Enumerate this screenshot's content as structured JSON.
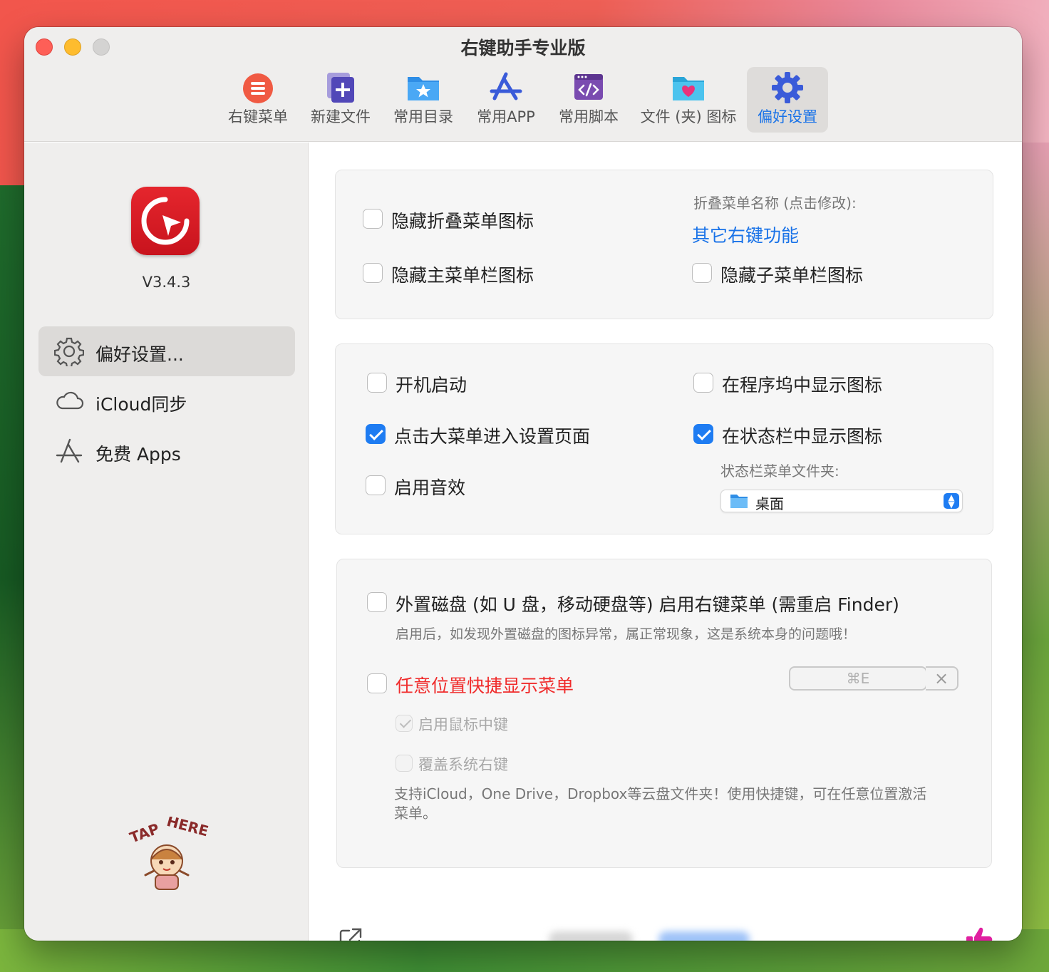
{
  "window": {
    "title": "右键助手专业版"
  },
  "toolbar": {
    "items": [
      {
        "label": "右键菜单",
        "icon": "context-menu-icon"
      },
      {
        "label": "新建文件",
        "icon": "new-file-icon"
      },
      {
        "label": "常用目录",
        "icon": "favorite-folder-icon"
      },
      {
        "label": "常用APP",
        "icon": "app-store-icon"
      },
      {
        "label": "常用脚本",
        "icon": "script-icon"
      },
      {
        "label": "文件 (夹) 图标",
        "icon": "folder-heart-icon"
      },
      {
        "label": "偏好设置",
        "icon": "gear-icon",
        "active": true
      }
    ]
  },
  "sidebar": {
    "version": "V3.4.3",
    "items": [
      {
        "label": "偏好设置...",
        "icon": "gear-icon",
        "active": true
      },
      {
        "label": "iCloud同步",
        "icon": "cloud-icon"
      },
      {
        "label": "免费 Apps",
        "icon": "app-store-icon"
      }
    ],
    "mascot_text": "TAP HERE"
  },
  "panel1": {
    "hide_fold_icon": {
      "label": "隐藏折叠菜单图标",
      "checked": false
    },
    "hide_main_icon": {
      "label": "隐藏主菜单栏图标",
      "checked": false
    },
    "fold_name_caption": "折叠菜单名称 (点击修改):",
    "fold_name_value": "其它右键功能",
    "hide_sub_icon": {
      "label": "隐藏子菜单栏图标",
      "checked": false
    }
  },
  "panel2": {
    "launch_at_login": {
      "label": "开机启动",
      "checked": false
    },
    "click_enter_settings": {
      "label": "点击大菜单进入设置页面",
      "checked": true
    },
    "enable_sound": {
      "label": "启用音效",
      "checked": false
    },
    "show_in_dock": {
      "label": "在程序坞中显示图标",
      "checked": false
    },
    "show_in_statusbar": {
      "label": "在状态栏中显示图标",
      "checked": true
    },
    "statusbar_folder_caption": "状态栏菜单文件夹:",
    "statusbar_folder_value": "桌面"
  },
  "panel3": {
    "external_disk": {
      "label": "外置磁盘 (如 U 盘，移动硬盘等) 启用右键菜单 (需重启 Finder)",
      "checked": false
    },
    "external_disk_note": "启用后，如发现外置磁盘的图标异常，属正常现象，这是系统本身的问题哦！",
    "anywhere_menu": {
      "label": "任意位置快捷显示菜单",
      "checked": false
    },
    "shortcut_value": "⌘E",
    "middle_click": {
      "label": "启用鼠标中键",
      "checked": true
    },
    "override_right_click": {
      "label": "覆盖系统右键",
      "checked": false
    },
    "footer_note": "支持iCloud，One Drive，Dropbox等云盘文件夹！使用快捷键，可在任意位置激活菜单。"
  },
  "colors": {
    "accent": "#1e7cf2",
    "link": "#1a73e8",
    "warning": "#f02b2b",
    "brand": "#d81c24"
  }
}
